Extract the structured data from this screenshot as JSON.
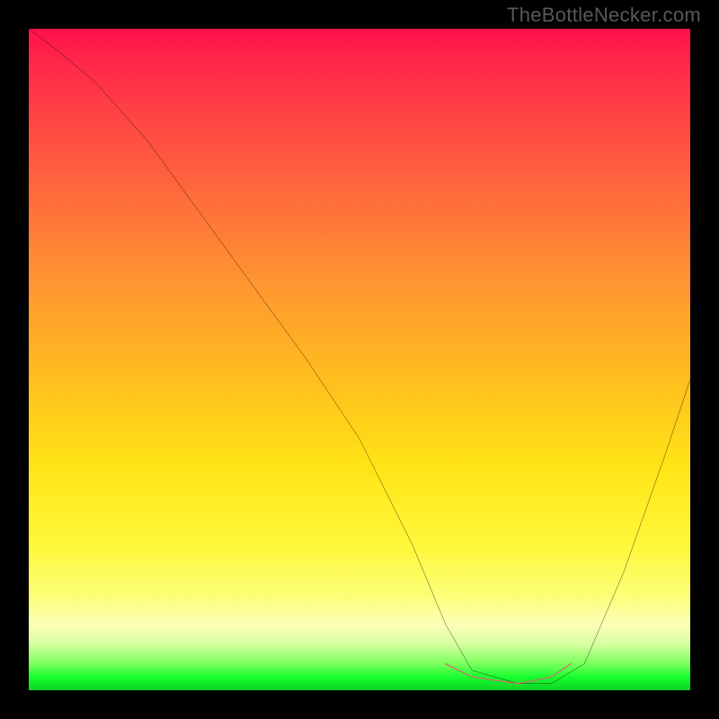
{
  "attribution": "TheBottleNecker.com",
  "chart_data": {
    "type": "line",
    "title": "",
    "xlabel": "",
    "ylabel": "",
    "xlim": [
      0,
      100
    ],
    "ylim": [
      0,
      100
    ],
    "series": [
      {
        "name": "curve",
        "x": [
          0,
          4,
          10,
          18,
          26,
          34,
          42,
          50,
          58,
          63,
          67,
          74,
          79,
          84,
          90,
          96,
          100
        ],
        "y": [
          100,
          97,
          92,
          83,
          72,
          61,
          50,
          38,
          22,
          10,
          3,
          1,
          1,
          4,
          18,
          35,
          47
        ]
      },
      {
        "name": "bottleneck-band",
        "x": [
          63,
          67,
          74,
          79,
          82
        ],
        "y": [
          4,
          2,
          1,
          2,
          4
        ]
      }
    ],
    "colors": {
      "curve": "#000000",
      "band": "#d46a6d",
      "gradient_top": "#ff1149",
      "gradient_mid": "#ffe416",
      "gradient_bot": "#0dd224"
    }
  }
}
